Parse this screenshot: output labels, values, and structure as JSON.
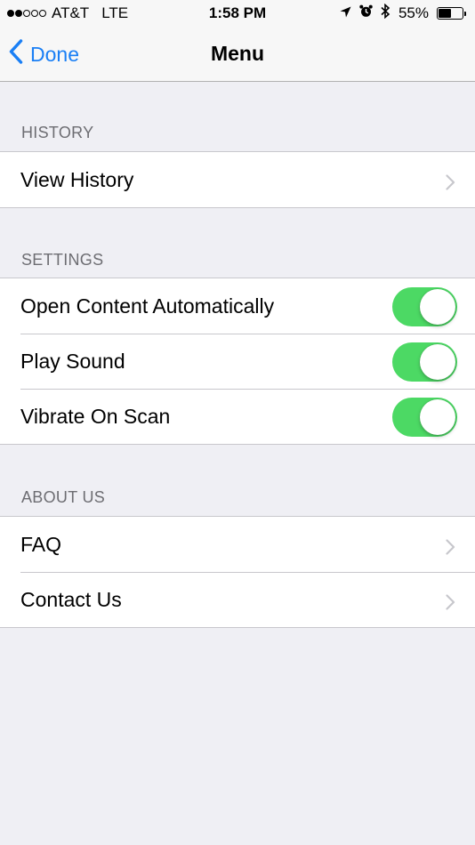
{
  "status_bar": {
    "carrier": "AT&T",
    "network": "LTE",
    "time": "1:58 PM",
    "battery_percent": "55%",
    "battery_level": 0.55,
    "signal_bars_filled": 2,
    "signal_bars_total": 5
  },
  "nav": {
    "back_label": "Done",
    "title": "Menu"
  },
  "sections": {
    "history": {
      "header": "HISTORY",
      "items": [
        {
          "label": "View History",
          "accessory": "chevron"
        }
      ]
    },
    "settings": {
      "header": "SETTINGS",
      "items": [
        {
          "label": "Open Content Automatically",
          "accessory": "toggle",
          "on": true
        },
        {
          "label": "Play Sound",
          "accessory": "toggle",
          "on": true
        },
        {
          "label": "Vibrate On Scan",
          "accessory": "toggle",
          "on": true
        }
      ]
    },
    "about": {
      "header": "ABOUT US",
      "items": [
        {
          "label": "FAQ",
          "accessory": "chevron"
        },
        {
          "label": "Contact Us",
          "accessory": "chevron"
        }
      ]
    }
  },
  "colors": {
    "accent": "#1a7ff5",
    "toggle_on": "#4cd964",
    "background": "#efeff4",
    "section_header": "#6d6d72"
  }
}
